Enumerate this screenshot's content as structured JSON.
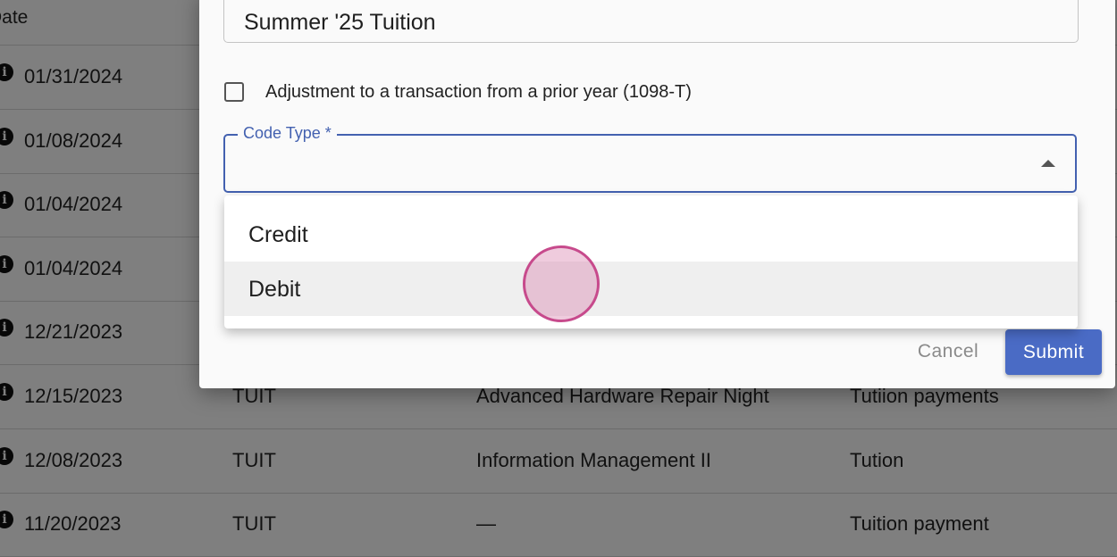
{
  "table": {
    "header_date": "Date",
    "rows": [
      {
        "date": "01/31/2024",
        "code": "",
        "description": "",
        "type": ""
      },
      {
        "date": "01/08/2024",
        "code": "",
        "description": "",
        "type": ""
      },
      {
        "date": "01/04/2024",
        "code": "",
        "description": "",
        "type": ""
      },
      {
        "date": "01/04/2024",
        "code": "",
        "description": "",
        "type": ""
      },
      {
        "date": "12/21/2023",
        "code": "",
        "description": "",
        "type": ""
      },
      {
        "date": "12/15/2023",
        "code": "TUIT",
        "description": "Advanced Hardware Repair Night",
        "type": "Tutiion payments"
      },
      {
        "date": "12/08/2023",
        "code": "TUIT",
        "description": "Information Management II",
        "type": "Tution"
      },
      {
        "date": "11/20/2023",
        "code": "TUIT",
        "description": "—",
        "type": "Tuition payment"
      }
    ]
  },
  "dialog": {
    "description_value": "Summer '25 Tuition",
    "checkbox_label": "Adjustment to a transaction from a prior year (1098-T)",
    "checkbox_checked": false,
    "code_type_label": "Code Type *",
    "code_type_options": [
      "Credit",
      "Debit"
    ],
    "hovered_option": "Debit",
    "cancel_label": "Cancel",
    "submit_label": "Submit"
  },
  "colors": {
    "accent": "#4361b0",
    "submit_bg": "#4a6bc5"
  }
}
